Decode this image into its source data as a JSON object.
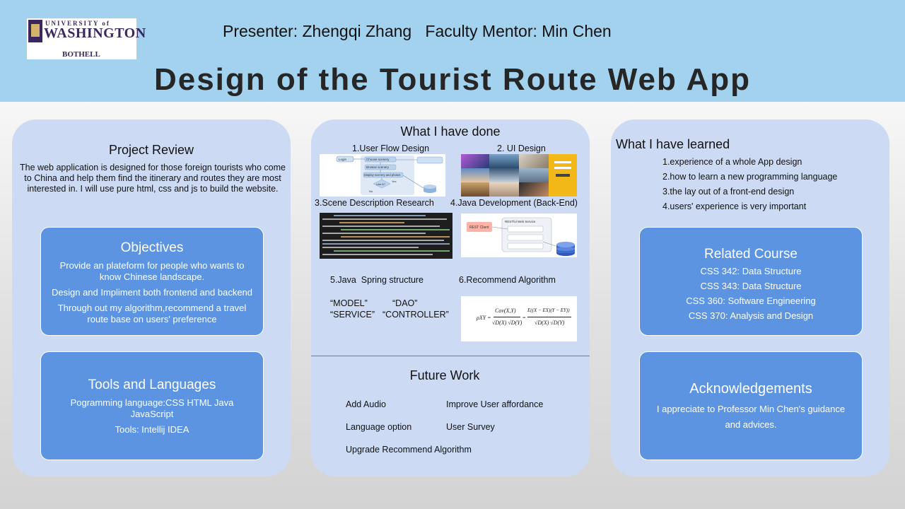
{
  "header": {
    "logo": {
      "line1": "UNIVERSITY of",
      "line2": "WASHINGTON",
      "line3": "BOTHELL"
    },
    "presenter": "Presenter: Zhengqi Zhang   Faculty Mentor: Min Chen",
    "title": "Design of the Tourist Route Web App"
  },
  "left": {
    "project_review": {
      "heading": "Project Review",
      "body": "The web application is designed for those foreign tourists who come to China and help them find the itinerary and routes they are most interested in. I will use pure html, css and js to build the website."
    },
    "objectives": {
      "heading": "Objectives",
      "items": [
        "Provide an plateform for people who wants to know Chinese landscape.",
        "Design and Impliment both frontend and backend",
        "Through out my algorithm,recommend a travel route base on users' preference"
      ]
    },
    "tools": {
      "heading": "Tools and Languages",
      "items": [
        "Pogramming language:CSS HTML Java JavaScript",
        "Tools: Intellij IDEA"
      ]
    }
  },
  "middle": {
    "heading": "What I have done",
    "labels": {
      "user_flow": "1.User Flow Design",
      "ui_design": "2. UI Design",
      "scene": "3.Scene Description Research",
      "java_dev": "4.Java Development (Back-End)",
      "spring": "5.Java  Spring structure",
      "recommend": "6.Recommend Algorithm"
    },
    "spring_terms": {
      "model": "“MODEL”",
      "dao": "“DAO”",
      "service": "“SERVICE”",
      "controller": "“CONTROLLER”"
    },
    "diagram_text": {
      "login": "Login",
      "browse": "Browse scenery",
      "choose": "Choose scenery",
      "display": "Display scenery and photos",
      "like": "Like it?",
      "yes": "Yes",
      "no": "No",
      "rest_client": "REST Client",
      "rest_service": "RESTful Web Service"
    },
    "formula": {
      "lhs": "ρXY = ",
      "num1": "Cov(X,Y)",
      "den1": "√D(X) √D(Y)",
      "num2": "E((X − EX)(Y − EY))",
      "den2": "√D(X) √D(Y)"
    },
    "future": {
      "heading": "Future Work",
      "items": [
        "Add Audio",
        "Improve User affordance",
        "Language option",
        "User Survey",
        "Upgrade Recommend Algorithm"
      ]
    }
  },
  "right": {
    "learned": {
      "heading": "What I have learned",
      "items": [
        "1.experience of a whole App design",
        "2.how to learn a new programming language",
        "3.the lay out of a front-end design",
        "4.users' experience is very important"
      ]
    },
    "courses": {
      "heading": "Related Course",
      "items": [
        "CSS 342: Data Structure",
        "CSS 343: Data Structure",
        "CSS 360: Software Engineering",
        "CSS 370: Analysis and Design"
      ]
    },
    "ack": {
      "heading": "Acknowledgements",
      "body": "I appreciate to Professor Min Chen's guidance and advices."
    }
  },
  "colors": {
    "header_bg": "#a3d2ef",
    "panel_bg": "#ccdaf3",
    "box_bg": "#5c94e1",
    "title_text": "#262626",
    "rest_client": "#ffb3a7",
    "database": "#3e6ad0"
  }
}
